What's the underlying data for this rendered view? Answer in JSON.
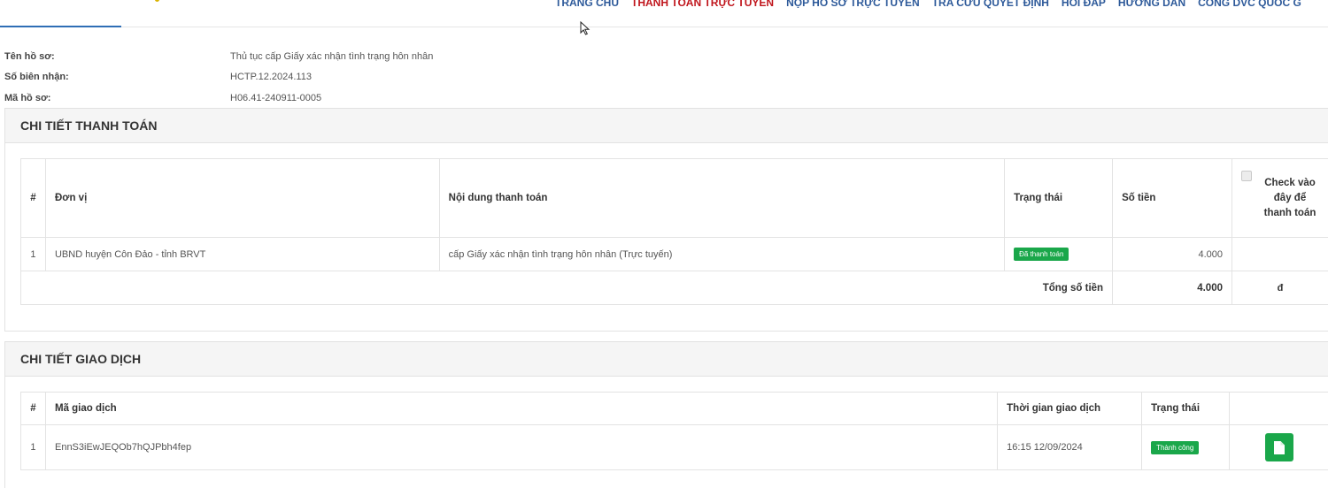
{
  "nav": {
    "items": [
      {
        "label": "TRANG CHỦ",
        "active": false
      },
      {
        "label": "THANH TOÁN TRỰC TUYẾN",
        "active": true
      },
      {
        "label": "NỘP HỒ SƠ TRỰC TUYẾN",
        "active": false
      },
      {
        "label": "TRA CỨU QUYẾT ĐỊNH",
        "active": false
      },
      {
        "label": "HỎI ĐÁP",
        "active": false
      },
      {
        "label": "HƯỚNG DẪN",
        "active": false
      },
      {
        "label": "CỔNG DVC QUỐC G",
        "active": false
      }
    ]
  },
  "info": {
    "ten_ho_so_label": "Tên hồ sơ:",
    "ten_ho_so_value": "Thủ tục cấp Giấy xác nhận tình trạng hôn nhân",
    "so_bien_nhan_label": "Số biên nhận:",
    "so_bien_nhan_value": "HCTP.12.2024.113",
    "ma_ho_so_label": "Mã hồ sơ:",
    "ma_ho_so_value": "H06.41-240911-0005"
  },
  "payment": {
    "title": "CHI TIẾT THANH TOÁN",
    "headers": {
      "index": "#",
      "unit": "Đơn vị",
      "content": "Nội dung thanh toán",
      "status": "Trạng thái",
      "amount": "Số tiền",
      "check": "Check vào đây để thanh toán"
    },
    "rows": [
      {
        "index": "1",
        "unit": "UBND huyện Côn Đảo - tỉnh BRVT",
        "content": "cấp Giấy xác nhận tình trạng hôn nhân (Trực tuyến)",
        "status": "Đã thanh toán",
        "amount": "4.000"
      }
    ],
    "total_label": "Tổng số tiền",
    "total_value": "4.000",
    "currency": "đ"
  },
  "transaction": {
    "title": "CHI TIẾT GIAO DỊCH",
    "headers": {
      "index": "#",
      "code": "Mã giao dịch",
      "time": "Thời gian giao dịch",
      "status": "Trạng thái"
    },
    "rows": [
      {
        "index": "1",
        "code": "EnnS3iEwJEQOb7hQJPbh4fep",
        "time": "16:15 12/09/2024",
        "status": "Thành công",
        "action_icon": "file-icon"
      }
    ]
  },
  "colors": {
    "nav_text": "#2e5a9a",
    "nav_active": "#c0161d",
    "badge_green": "#1aa74a"
  }
}
